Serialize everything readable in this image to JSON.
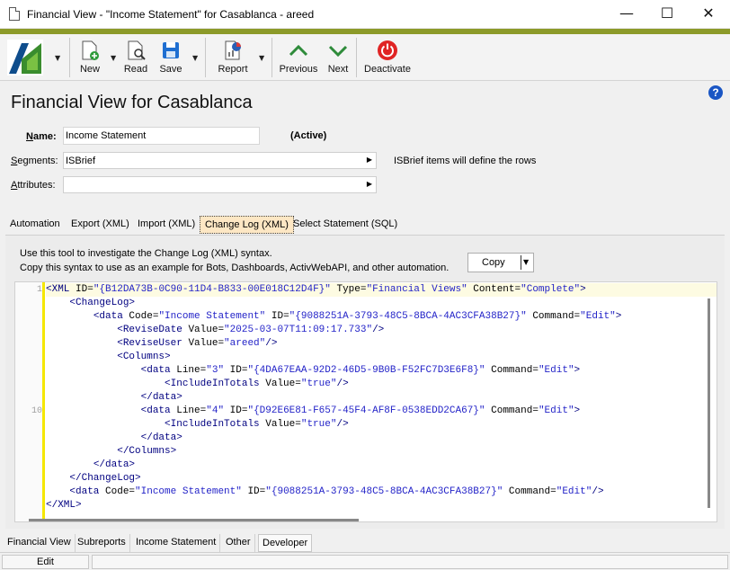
{
  "window": {
    "title": "Financial View - \"Income Statement\" for Casablanca - areed",
    "minimize": "—",
    "maximize": "☐",
    "close": "✕"
  },
  "toolbar": {
    "new_label": "New",
    "read_label": "Read",
    "save_label": "Save",
    "report_label": "Report",
    "previous_label": "Previous",
    "next_label": "Next",
    "deactivate_label": "Deactivate"
  },
  "page": {
    "title": "Financial View for Casablanca",
    "help": "?"
  },
  "form": {
    "name_label_first": "N",
    "name_label_rest": "ame:",
    "name_value": "Income Statement",
    "status": "(Active)",
    "segments_label_first": "S",
    "segments_label_rest": "egments:",
    "segments_value": "ISBrief",
    "segments_hint": "ISBrief items will define the rows",
    "attributes_label_first": "A",
    "attributes_label_rest": "ttributes:",
    "attributes_value": ""
  },
  "tabs": [
    {
      "label": "Automation"
    },
    {
      "label": "Export (XML)"
    },
    {
      "label": "Import (XML)"
    },
    {
      "label": "Change Log (XML)",
      "active": true
    },
    {
      "label": "Select Statement (SQL)"
    }
  ],
  "changelog": {
    "info_line1": "Use this tool to investigate the Change Log (XML) syntax.",
    "info_line2": "Copy this syntax to use as an example for Bots, Dashboards, ActivWebAPI, and other automation.",
    "copy_label": "Copy"
  },
  "xml": {
    "line_numbers": [
      "1",
      "10"
    ],
    "l1": {
      "open": "<XML ",
      "a1": "ID=",
      "v1": "\"{B12DA73B-0C90-11D4-B833-00E018C12D4F}\"",
      "a2": " Type=",
      "v2": "\"Financial Views\"",
      "a3": " Content=",
      "v3": "\"Complete\"",
      "close": ">"
    },
    "l2": "<ChangeLog>",
    "l3": {
      "open": "<data ",
      "a1": "Code=",
      "v1": "\"Income Statement\"",
      "a2": " ID=",
      "v2": "\"{9088251A-3793-48C5-8BCA-4AC3CFA38B27}\"",
      "a3": " Command=",
      "v3": "\"Edit\"",
      "close": ">"
    },
    "l4": {
      "open": "<ReviseDate ",
      "a1": "Value=",
      "v1": "\"2025-03-07T11:09:17.733\"",
      "close": "/>"
    },
    "l5": {
      "open": "<ReviseUser ",
      "a1": "Value=",
      "v1": "\"areed\"",
      "close": "/>"
    },
    "l6": "<Columns>",
    "l7": {
      "open": "<data ",
      "a1": "Line=",
      "v1": "\"3\"",
      "a2": " ID=",
      "v2": "\"{4DA67EAA-92D2-46D5-9B0B-F52FC7D3E6F8}\"",
      "a3": " Command=",
      "v3": "\"Edit\"",
      "close": ">"
    },
    "l8": {
      "open": "<IncludeInTotals ",
      "a1": "Value=",
      "v1": "\"true\"",
      "close": "/>"
    },
    "l9": "</data>",
    "l10": {
      "open": "<data ",
      "a1": "Line=",
      "v1": "\"4\"",
      "a2": " ID=",
      "v2": "\"{D92E6E81-F657-45F4-AF8F-0538EDD2CA67}\"",
      "a3": " Command=",
      "v3": "\"Edit\"",
      "close": ">"
    },
    "l11": {
      "open": "<IncludeInTotals ",
      "a1": "Value=",
      "v1": "\"true\"",
      "close": "/>"
    },
    "l12": "</data>",
    "l13": "</Columns>",
    "l14": "</data>",
    "l15": "</ChangeLog>",
    "l16": {
      "open": "<data ",
      "a1": "Code=",
      "v1": "\"Income Statement\"",
      "a2": " ID=",
      "v2": "\"{9088251A-3793-48C5-8BCA-4AC3CFA38B27}\"",
      "a3": " Command=",
      "v3": "\"Edit\"",
      "close": "/>"
    },
    "l17": "</XML>"
  },
  "bottom_tabs": [
    {
      "label": "Financial View"
    },
    {
      "label": "Subreports"
    },
    {
      "label": "Income Statement"
    },
    {
      "label": "Other"
    },
    {
      "label": "Developer",
      "active": true
    }
  ],
  "statusbar": {
    "mode": "Edit"
  },
  "colors": {
    "accent": "#8c9a29",
    "active_tab": "#fde7c4",
    "xml_tag": "#000080",
    "xml_value": "#2323c8",
    "fold_marker": "#f5e700"
  }
}
